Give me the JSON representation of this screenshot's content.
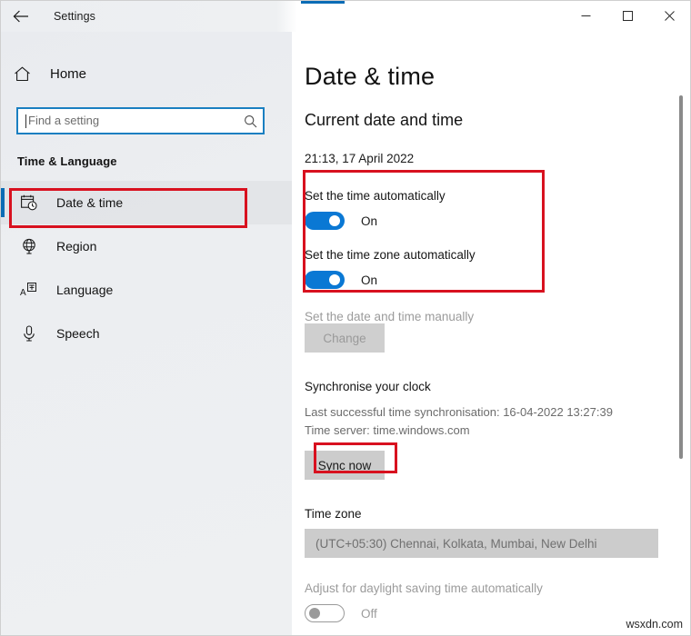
{
  "window": {
    "title": "Settings",
    "back_icon": "back-arrow-icon",
    "minimize_label": "—",
    "maximize_label": "□",
    "close_label": "✕"
  },
  "sidebar": {
    "home_label": "Home",
    "home_icon": "home-icon",
    "search": {
      "placeholder": "Find a setting",
      "value": "",
      "icon": "search-icon"
    },
    "group_title": "Time & Language",
    "items": [
      {
        "label": "Date & time",
        "icon": "calendar-clock-icon",
        "selected": true
      },
      {
        "label": "Region",
        "icon": "globe-icon",
        "selected": false
      },
      {
        "label": "Language",
        "icon": "language-icon",
        "selected": false
      },
      {
        "label": "Speech",
        "icon": "microphone-icon",
        "selected": false
      }
    ]
  },
  "main": {
    "page_title": "Date & time",
    "section_current": "Current date and time",
    "current_datetime": "21:13, 17 April 2022",
    "set_time_auto_label": "Set the time automatically",
    "set_time_auto_state": "On",
    "set_timezone_auto_label": "Set the time zone automatically",
    "set_timezone_auto_state": "On",
    "set_manual_label": "Set the date and time manually",
    "change_button": "Change",
    "section_sync": "Synchronise your clock",
    "last_sync": "Last successful time synchronisation: 16-04-2022 13:27:39",
    "time_server": "Time server: time.windows.com",
    "sync_now_button": "Sync now",
    "section_timezone": "Time zone",
    "timezone_value": "(UTC+05:30) Chennai, Kolkata, Mumbai, New Delhi",
    "dst_label": "Adjust for daylight saving time automatically",
    "dst_state": "Off"
  },
  "annotations": {
    "colors": {
      "highlight": "#d8111f",
      "accent": "#0a78d4",
      "focus": "#1a7fc1"
    }
  },
  "watermark": "wsxdn.com"
}
